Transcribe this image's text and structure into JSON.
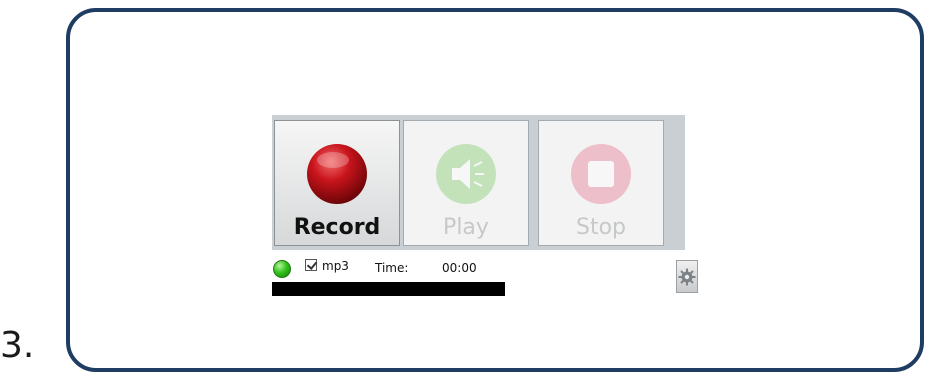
{
  "step_label": "3.",
  "recorder": {
    "buttons": {
      "record": "Record",
      "play": "Play",
      "stop": "Stop"
    },
    "status": {
      "format_label": "mp3",
      "format_checked": true,
      "time_label": "Time:",
      "time_value": "00:00"
    },
    "icons": {
      "record": "record-icon",
      "play": "speaker-icon",
      "stop": "stop-icon",
      "status": "status-led-icon",
      "settings": "gear-icon"
    },
    "colors": {
      "record": "#b5121b",
      "play": "#7fd06a",
      "stop": "#e77a96",
      "led": "#33c21b",
      "frame": "#1f3d63"
    }
  }
}
